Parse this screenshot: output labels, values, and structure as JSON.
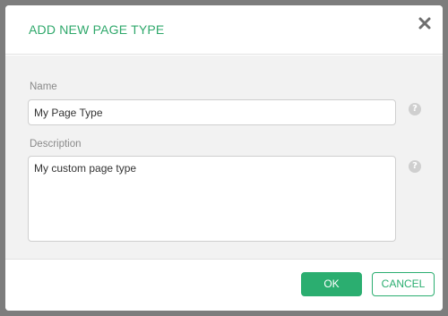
{
  "dialog": {
    "title": "ADD NEW PAGE TYPE",
    "close_icon": "close-icon"
  },
  "form": {
    "name": {
      "label": "Name",
      "value": "My Page Type",
      "help_icon": "help-icon"
    },
    "description": {
      "label": "Description",
      "value": "My custom page type",
      "help_icon": "help-icon"
    }
  },
  "help_glyph": "?",
  "footer": {
    "ok_label": "OK",
    "cancel_label": "CANCEL"
  },
  "colors": {
    "accent": "#2bae70",
    "title": "#2fa86b",
    "overlay": "#7d7d7d",
    "body_background": "#f2f2f2"
  }
}
